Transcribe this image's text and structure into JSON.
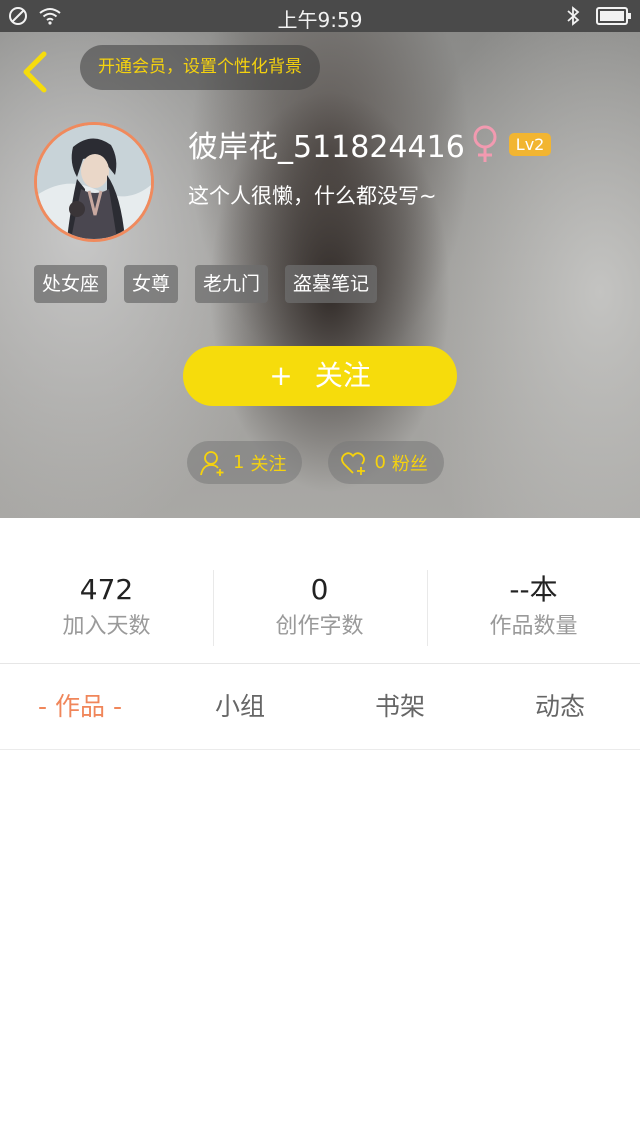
{
  "status_bar": {
    "time": "上午9:59",
    "icons": [
      "no-disturb-icon",
      "wifi-icon",
      "bluetooth-icon",
      "battery-icon"
    ]
  },
  "header": {
    "vip_prompt": "开通会员，设置个性化背景",
    "username": "彼岸花_511824416",
    "gender_symbol": "♀",
    "level": "Lv2",
    "bio": "这个人很懒，什么都没写~",
    "tags": [
      "处女座",
      "女尊",
      "老九门",
      "盗墓笔记"
    ],
    "follow_button": {
      "plus": "+",
      "label": "关注"
    },
    "following": {
      "count": "1",
      "label": "关注"
    },
    "fans": {
      "count": "0",
      "label": "粉丝"
    }
  },
  "stats": [
    {
      "value": "472",
      "label": "加入天数"
    },
    {
      "value": "0",
      "label": "创作字数"
    },
    {
      "value": "--本",
      "label": "作品数量"
    }
  ],
  "tabs": [
    {
      "label": "作品",
      "active": true
    },
    {
      "label": "小组",
      "active": false
    },
    {
      "label": "书架",
      "active": false
    },
    {
      "label": "动态",
      "active": false
    }
  ],
  "colors": {
    "accent_yellow": "#f6dc0c",
    "vip_text": "#f5d20e",
    "active_tab": "#f08a5d",
    "gender": "#f29ab0",
    "level_badge": "#f2b531"
  }
}
